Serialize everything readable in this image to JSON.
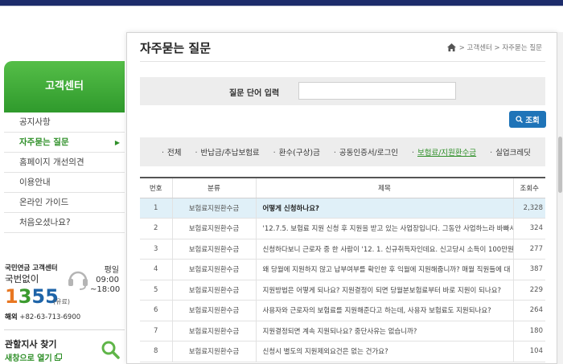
{
  "sidebar": {
    "title": "고객센터",
    "items": [
      {
        "label": "공지사항",
        "active": false
      },
      {
        "label": "자주묻는 질문",
        "active": true
      },
      {
        "label": "홈페이지 개선의견",
        "active": false
      },
      {
        "label": "이용안내",
        "active": false
      },
      {
        "label": "온라인 가이드",
        "active": false
      },
      {
        "label": "처음오셨나요?",
        "active": false
      }
    ],
    "arrow": "▶"
  },
  "contact": {
    "title": "국민연금 고객센터",
    "subtitle": "국번없이",
    "phone_1": "1",
    "phone_2": "3",
    "phone_3": "55",
    "paid": "(유료)",
    "hours_label": "평일",
    "hours_start": "09:00",
    "hours_end": "~18:00",
    "intl_label": "해외",
    "intl_number": "+82-63-713-6900"
  },
  "branch": {
    "title": "관할지사 찾기",
    "link": "새창으로 열기"
  },
  "page": {
    "title": "자주묻는 질문",
    "breadcrumb": "> 고객센터 > 자주묻는 질문"
  },
  "search": {
    "label": "질문 단어 입력",
    "value": "",
    "placeholder": "",
    "button": "조회"
  },
  "categories": [
    {
      "label": "전체",
      "active": false
    },
    {
      "label": "반납금/추납보험료",
      "active": false
    },
    {
      "label": "환수(구상)금",
      "active": false
    },
    {
      "label": "공동인증서/로그인",
      "active": false
    },
    {
      "label": "보험료/지원환수금",
      "active": true
    },
    {
      "label": "실업크레딧",
      "active": false
    }
  ],
  "table": {
    "headers": {
      "no": "번호",
      "category": "분류",
      "title": "제목",
      "views": "조회수"
    },
    "rows": [
      {
        "no": "1",
        "category": "보험료지원환수금",
        "title": "어떻게 신청하나요?",
        "views": "2,328",
        "highlight": true
      },
      {
        "no": "2",
        "category": "보험료지원환수금",
        "title": "'12.7.5. 보험료 지원 신청 후 지원을 받고 있는 사업장입니다. 그동안 사업하느라 바빠서",
        "views": "324",
        "highlight": false
      },
      {
        "no": "3",
        "category": "보험료지원환수금",
        "title": "신청하다보니 근로자 중 한 사람이 '12. 1. 신규취득자인데요. 신고당시 소득이 100만원",
        "views": "277",
        "highlight": false
      },
      {
        "no": "4",
        "category": "보험료지원환수금",
        "title": "왜 당월에 지원하지 않고 납부여부를 확인한 후 익월에 지원해줍니까? 매월 직원들에 대",
        "views": "387",
        "highlight": false
      },
      {
        "no": "5",
        "category": "보험료지원환수금",
        "title": "지원방법은 어떻게 되나요? 지원결정이 되면 당월분보험료부터 바로 지원이 되나요?",
        "views": "229",
        "highlight": false
      },
      {
        "no": "6",
        "category": "보험료지원환수금",
        "title": "사용자와 근로자의 보험료를 지원해준다고 하는데, 사용자 보험료도 지원되나요?",
        "views": "264",
        "highlight": false
      },
      {
        "no": "7",
        "category": "보험료지원환수금",
        "title": "지원결정되면 계속 지원되나요? 중단사유는 없습니까?",
        "views": "180",
        "highlight": false
      },
      {
        "no": "8",
        "category": "보험료지원환수금",
        "title": "신청시 별도의 지원제외요건은 없는 건가요?",
        "views": "104",
        "highlight": false
      }
    ]
  },
  "colors": {
    "brand_green": "#3b9a2e",
    "navy": "#1d2c6b",
    "button_blue": "#1f74b8",
    "highlight_row": "#e0f0f8"
  },
  "icons": [
    "home-icon",
    "search-icon",
    "headset-icon",
    "magnifier-icon",
    "new-window-icon",
    "chevron-right-icon"
  ]
}
